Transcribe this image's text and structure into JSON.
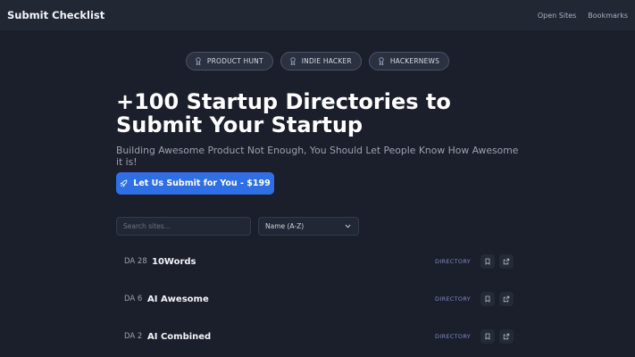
{
  "header": {
    "brand": "Submit Checklist",
    "nav": [
      "Open Sites",
      "Bookmarks"
    ]
  },
  "badges": [
    "PRODUCT HUNT",
    "INDIE HACKER",
    "HACKERNEWS"
  ],
  "hero": {
    "title": "+100 Startup Directories to Submit Your Startup",
    "subtitle": "Building Awesome Product Not Enough, You Should Let People Know How Awesome it is!",
    "cta_label": "Let Us Submit for You - $199"
  },
  "filters": {
    "search_placeholder": "Search sites...",
    "sort_value": "Name (A-Z)"
  },
  "sites": [
    {
      "da": "DA 28",
      "name": "10Words",
      "tag": "DIRECTORY"
    },
    {
      "da": "DA 6",
      "name": "AI Awesome",
      "tag": "DIRECTORY"
    },
    {
      "da": "DA 2",
      "name": "AI Combined",
      "tag": "DIRECTORY"
    }
  ],
  "colors": {
    "background": "#1b1f2b",
    "header": "#222734",
    "accent": "#2f6fe6",
    "tag": "#7f88c9"
  }
}
